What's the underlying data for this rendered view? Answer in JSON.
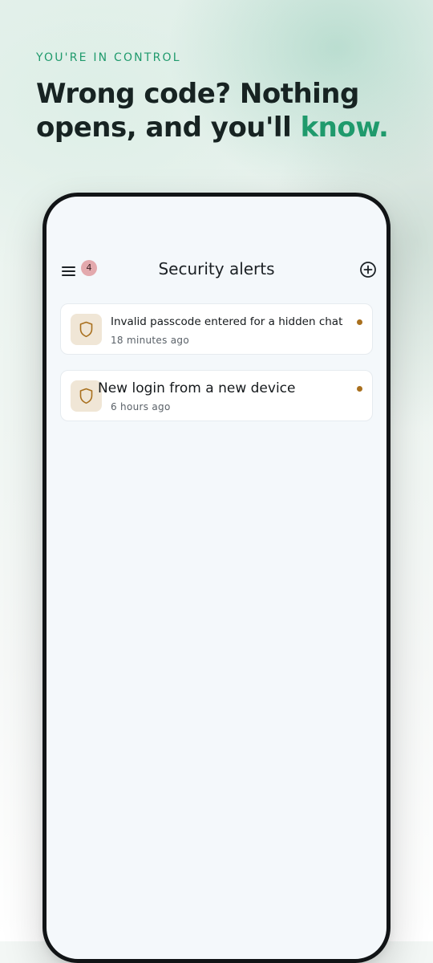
{
  "hero": {
    "eyebrow": "YOU'RE IN CONTROL",
    "headline_main": "Wrong code? Nothing opens, and you'll ",
    "headline_accent": "know.",
    "accent_color": "#1f9a6c"
  },
  "app": {
    "title": "Security alerts",
    "menu_badge": "4",
    "menu_icon": "hamburger-menu-icon",
    "add_icon": "plus-circle-icon"
  },
  "alerts": [
    {
      "text": "Invalid passcode entered for a hidden chat",
      "time": "18 minutes ago",
      "icon": "shield-icon",
      "unread": true
    },
    {
      "text": "New login from a new device",
      "time": "6 hours ago",
      "icon": "shield-icon",
      "unread": true
    }
  ],
  "colors": {
    "shield_tile": "#f0e6d6",
    "shield_stroke": "#a9701e",
    "unread_dot": "#a9701e",
    "badge": "#e3a9ad"
  }
}
